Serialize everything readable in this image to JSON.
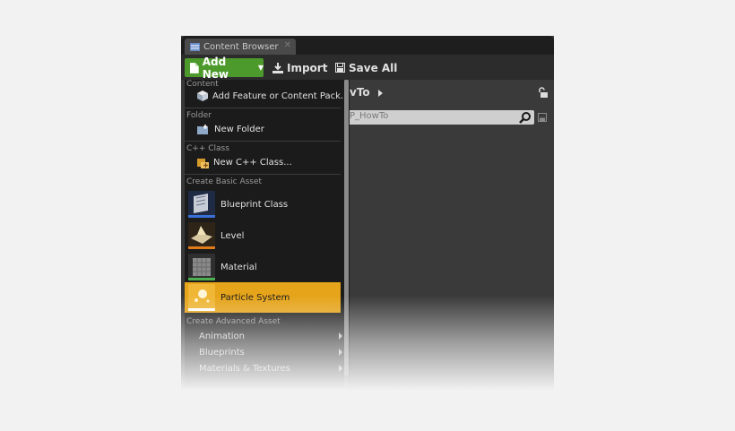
{
  "window": {
    "tab_label": "Content Browser",
    "tab_close": "✕"
  },
  "toolbar": {
    "add_new_label": "Add New",
    "import_label": "Import",
    "save_all_label": "Save All"
  },
  "path": {
    "text": "vTo"
  },
  "search": {
    "value": "P_HowTo"
  },
  "menu": {
    "sections": {
      "content": "Content",
      "folder": "Folder",
      "cpp_class": "C++ Class",
      "basic_asset": "Create Basic Asset",
      "advanced_asset": "Create Advanced Asset"
    },
    "items": {
      "add_feature": "Add Feature or Content Pack...",
      "new_folder": "New Folder",
      "new_cpp_class": "New C++ Class..."
    },
    "basic_assets": [
      {
        "label": "Blueprint Class",
        "accent": "#3a6fd8"
      },
      {
        "label": "Level",
        "accent": "#e07b1a"
      },
      {
        "label": "Material",
        "accent": "#4caf50"
      },
      {
        "label": "Particle System",
        "accent": "#ffffff"
      }
    ],
    "advanced_assets": [
      "Animation",
      "Blueprints",
      "Materials & Textures"
    ]
  },
  "colors": {
    "add_new_bg": "#4d9a2c",
    "selected_bg": "#e6a41a"
  }
}
